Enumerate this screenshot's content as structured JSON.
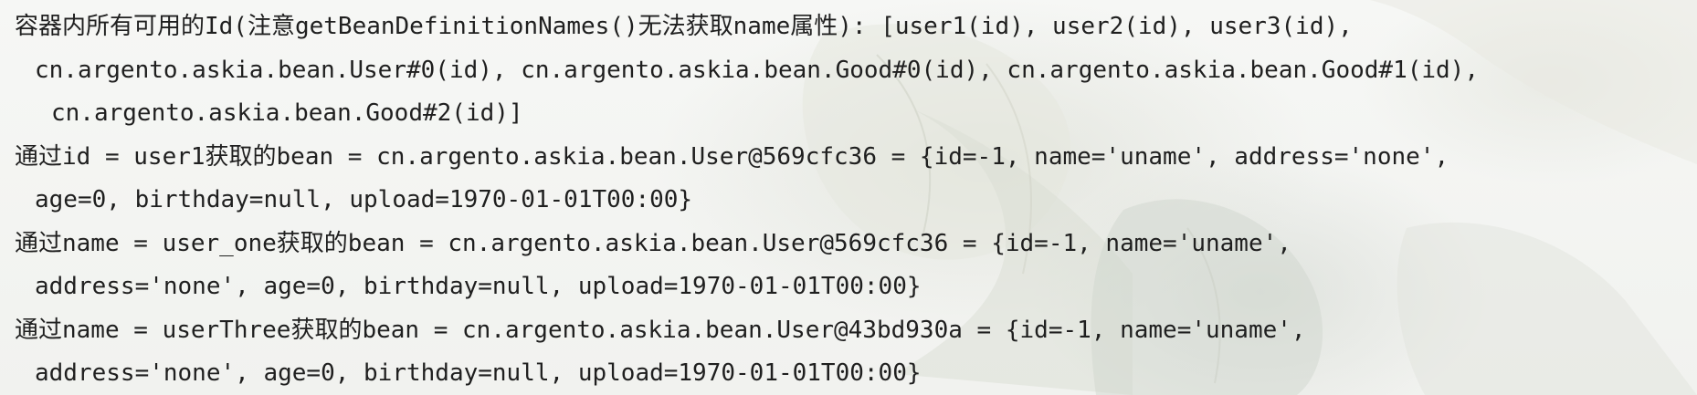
{
  "console": {
    "lines": [
      {
        "text": "容器内所有可用的Id(注意getBeanDefinitionNames()无法获取name属性): [user1(id), user2(id), user3(id),",
        "indent": 0
      },
      {
        "text": "cn.argento.askia.bean.User#0(id), cn.argento.askia.bean.Good#0(id), cn.argento.askia.bean.Good#1(id),",
        "indent": 1
      },
      {
        "text": "cn.argento.askia.bean.Good#2(id)]",
        "indent": 2
      },
      {
        "text": "通过id = user1获取的bean = cn.argento.askia.bean.User@569cfc36 = {id=-1, name='uname', address='none',",
        "indent": 0
      },
      {
        "text": "age=0, birthday=null, upload=1970-01-01T00:00}",
        "indent": 1
      },
      {
        "text": "通过name = user_one获取的bean = cn.argento.askia.bean.User@569cfc36 = {id=-1, name='uname',",
        "indent": 0
      },
      {
        "text": "address='none', age=0, birthday=null, upload=1970-01-01T00:00}",
        "indent": 1
      },
      {
        "text": "通过name = userThree获取的bean = cn.argento.askia.bean.User@43bd930a = {id=-1, name='uname',",
        "indent": 0
      },
      {
        "text": "address='none', age=0, birthday=null, upload=1970-01-01T00:00}",
        "indent": 1
      }
    ]
  },
  "colors": {
    "text": "#1f1f1f",
    "background": "#f4f5f3"
  }
}
